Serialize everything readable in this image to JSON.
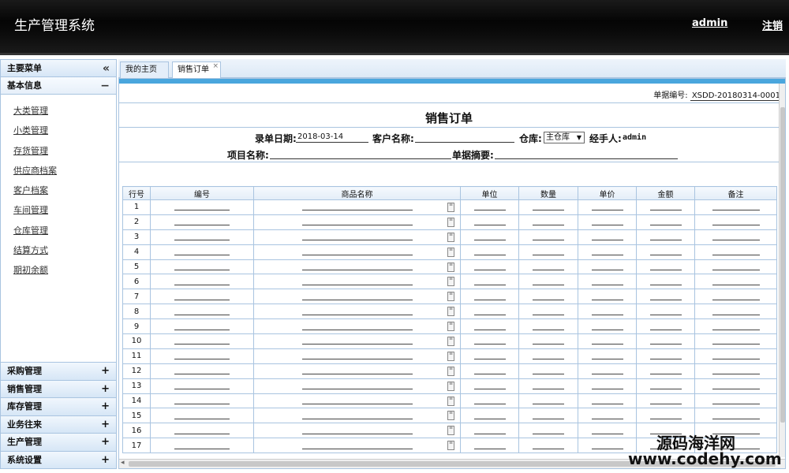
{
  "header": {
    "app_title": "生产管理系统",
    "user": "admin",
    "logout": "注销"
  },
  "sidebar": {
    "title": "主要菜单",
    "title_toggle": "«",
    "open_section": {
      "label": "基本信息",
      "toggle": "−"
    },
    "items": [
      "大类管理",
      "小类管理",
      "存货管理",
      "供应商档案",
      "客户档案",
      "车间管理",
      "仓库管理",
      "结算方式",
      "期初余额"
    ],
    "sections": [
      {
        "label": "采购管理",
        "toggle": "+"
      },
      {
        "label": "销售管理",
        "toggle": "+"
      },
      {
        "label": "库存管理",
        "toggle": "+"
      },
      {
        "label": "业务往来",
        "toggle": "+"
      },
      {
        "label": "生产管理",
        "toggle": "+"
      },
      {
        "label": "系统设置",
        "toggle": "+"
      }
    ]
  },
  "tabs": [
    {
      "label": "我的主页"
    },
    {
      "label": "销售订单",
      "close": "×"
    }
  ],
  "form": {
    "doc_no_label": "单据编号:",
    "doc_no": "XSDD-20180314-0001",
    "title": "销售订单",
    "date_label": "录单日期:",
    "date_value": "2018-03-14",
    "customer_label": "客户名称:",
    "warehouse_label": "仓库:",
    "warehouse_value": "主仓库",
    "handler_label": "经手人:",
    "handler_value": "admin",
    "project_label": "项目名称:",
    "summary_label": "单据摘要:"
  },
  "table": {
    "columns": [
      "行号",
      "编号",
      "商品名称",
      "单位",
      "数量",
      "单价",
      "金额",
      "备注"
    ],
    "rows": [
      "1",
      "2",
      "3",
      "4",
      "5",
      "6",
      "7",
      "8",
      "9",
      "10",
      "11",
      "12",
      "13",
      "14",
      "15",
      "16",
      "17"
    ]
  },
  "watermark": {
    "line1": "源码海洋网",
    "line2": "www.codehy.com"
  }
}
